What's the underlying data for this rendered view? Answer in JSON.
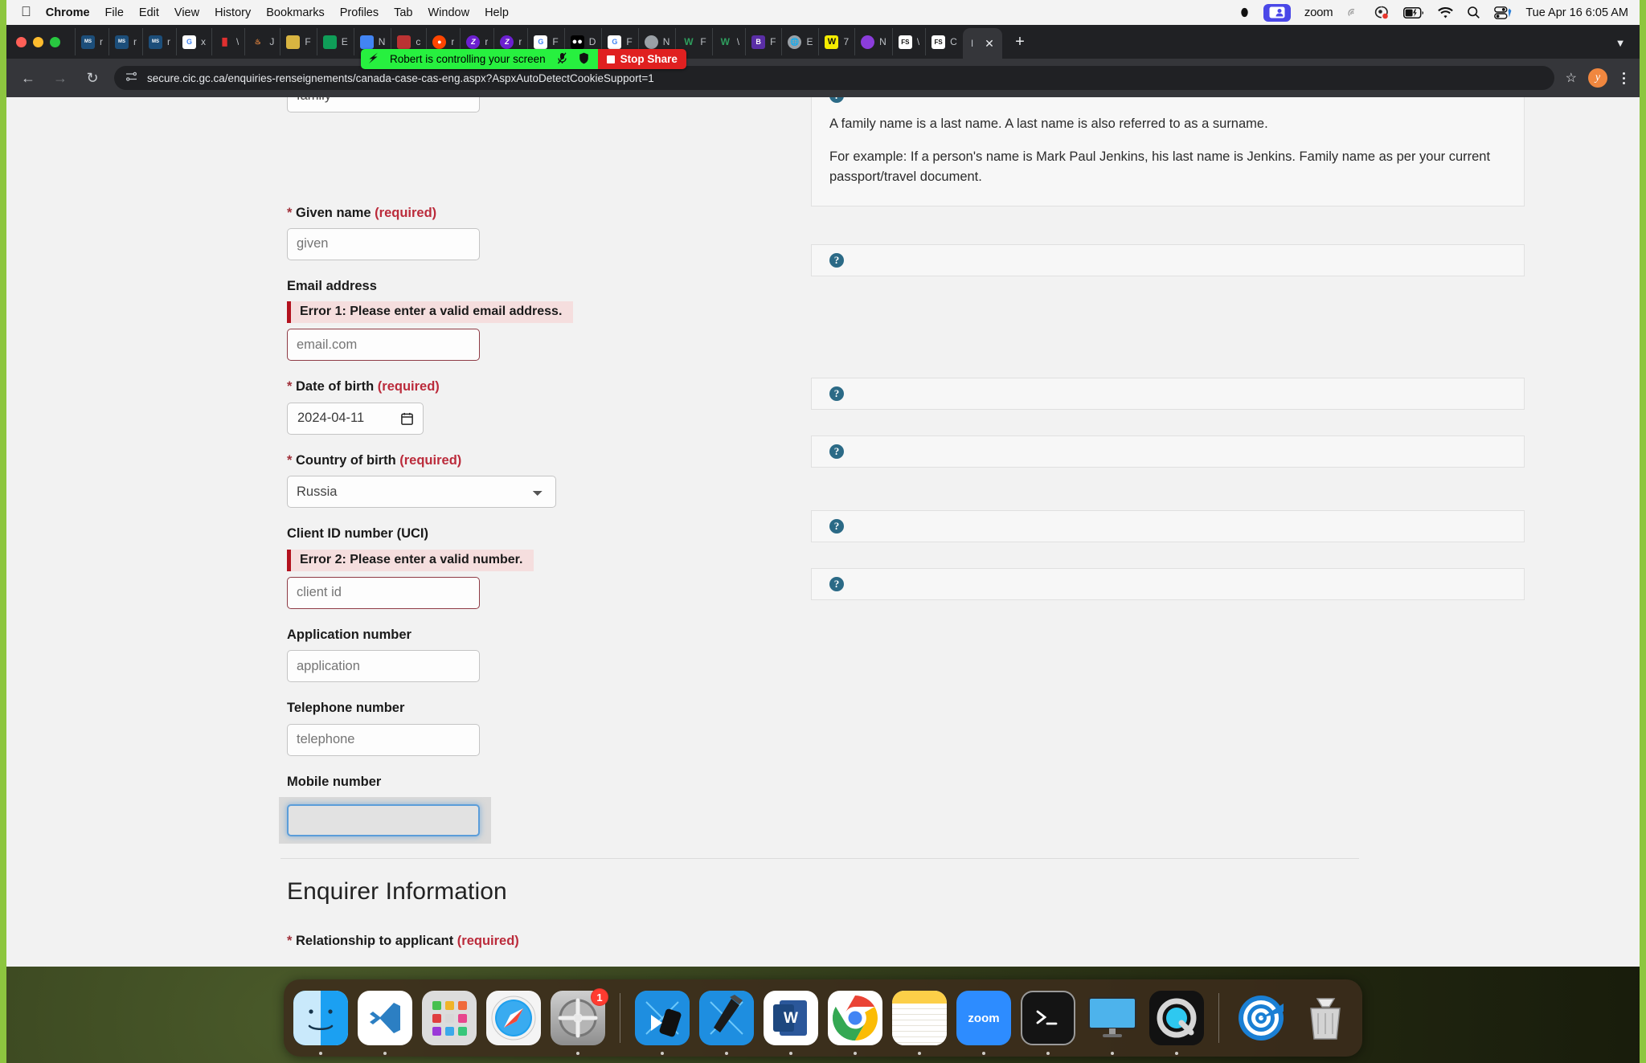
{
  "menubar": {
    "apple_icon": "apple-icon",
    "items": [
      {
        "label": "Chrome",
        "bold": true
      },
      {
        "label": "File",
        "bold": false
      },
      {
        "label": "Edit",
        "bold": false
      },
      {
        "label": "View",
        "bold": false
      },
      {
        "label": "History",
        "bold": false
      },
      {
        "label": "Bookmarks",
        "bold": false
      },
      {
        "label": "Profiles",
        "bold": false
      },
      {
        "label": "Tab",
        "bold": false
      },
      {
        "label": "Window",
        "bold": false
      },
      {
        "label": "Help",
        "bold": false
      }
    ],
    "status": {
      "record_icon": "record-dot-icon",
      "screenshare_icon": "screen-share-icon",
      "zoom_label": "zoom",
      "airplay_icon": "airplay-icon",
      "recording_icon": "screen-recording-icon",
      "battery_icon": "battery-charging-icon",
      "wifi_icon": "wifi-icon",
      "search_icon": "spotlight-search-icon",
      "controlcenter_icon": "control-center-icon",
      "datetime": "Tue Apr 16  6:05 AM"
    }
  },
  "sharebar": {
    "bolt_icon": "zoom-bolt-icon",
    "message": "Robert is controlling your screen",
    "mute_icon": "microphone-muted-icon",
    "shield_icon": "security-shield-icon",
    "stop_label": "Stop Share"
  },
  "browser": {
    "traffic_lights": [
      "close",
      "minimize",
      "maximize"
    ],
    "tabs": [
      {
        "favicon": "morgan-stanley-icon",
        "title": "r",
        "fav_bg": "#1c4e7a",
        "fav_text": "MS",
        "active": false
      },
      {
        "favicon": "morgan-stanley-icon",
        "title": "r",
        "fav_bg": "#1c4e7a",
        "fav_text": "MS",
        "active": false
      },
      {
        "favicon": "morgan-stanley-icon",
        "title": "r",
        "fav_bg": "#1c4e7a",
        "fav_text": "MS",
        "active": false
      },
      {
        "favicon": "google-icon",
        "title": "x",
        "fav_bg": "#ffffff",
        "fav_text": "G",
        "active": false
      },
      {
        "favicon": "pause-icon",
        "title": "\\",
        "fav_bg": "#202124",
        "fav_text": "II",
        "active": false
      },
      {
        "favicon": "java-icon",
        "title": "J",
        "fav_bg": "#202124",
        "fav_text": "J",
        "active": false
      },
      {
        "favicon": "unknown-icon",
        "title": "F",
        "fav_bg": "#d8b441",
        "fav_text": "",
        "active": false
      },
      {
        "favicon": "sheets-icon",
        "title": "E",
        "fav_bg": "#0f9d58",
        "fav_text": "",
        "active": false
      },
      {
        "favicon": "chrome-icon",
        "title": "N",
        "fav_bg": "#4285f4",
        "fav_text": "",
        "active": false
      },
      {
        "favicon": "unknown-icon",
        "title": "c",
        "fav_bg": "#b33",
        "fav_text": "",
        "active": false
      },
      {
        "favicon": "reddit-icon",
        "title": "r",
        "fav_bg": "#ff4500",
        "fav_text": "",
        "active": false
      },
      {
        "favicon": "zoom-icon",
        "title": "r",
        "fav_bg": "#6c20d0",
        "fav_text": "Z",
        "active": false
      },
      {
        "favicon": "zoom-icon",
        "title": "r",
        "fav_bg": "#6c20d0",
        "fav_text": "Z",
        "active": false
      },
      {
        "favicon": "google-icon",
        "title": "F",
        "fav_bg": "#ffffff",
        "fav_text": "G",
        "active": false
      },
      {
        "favicon": "medium-icon",
        "title": "D",
        "fav_bg": "#000000",
        "fav_text": "",
        "active": false
      },
      {
        "favicon": "google-icon",
        "title": "F",
        "fav_bg": "#ffffff",
        "fav_text": "G",
        "active": false
      },
      {
        "favicon": "chromium-icon",
        "title": "N",
        "fav_bg": "#9aa0a6",
        "fav_text": "",
        "active": false
      },
      {
        "favicon": "wolfram-icon",
        "title": "F",
        "fav_bg": "#202124",
        "fav_text": "W",
        "active": false
      },
      {
        "favicon": "wolfram-icon",
        "title": "\\",
        "fav_bg": "#202124",
        "fav_text": "W",
        "active": false
      },
      {
        "favicon": "bitbucket-icon",
        "title": "F",
        "fav_bg": "#5a2ea6",
        "fav_text": "B",
        "active": false
      },
      {
        "favicon": "globe-icon",
        "title": "E",
        "fav_bg": "#9aa0a6",
        "fav_text": "",
        "active": false
      },
      {
        "favicon": "wolfram-notebook-icon",
        "title": "7",
        "fav_bg": "#f5ec00",
        "fav_text": "W",
        "active": false
      },
      {
        "favicon": "roblox-icon",
        "title": "N",
        "fav_bg": "#8b3ddb",
        "fav_text": "",
        "active": false
      },
      {
        "favicon": "fs-icon",
        "title": "\\",
        "fav_bg": "#ffffff",
        "fav_text": "FS",
        "active": false
      },
      {
        "favicon": "fs-icon",
        "title": "C",
        "fav_bg": "#ffffff",
        "fav_text": "FS",
        "active": false
      },
      {
        "favicon": "active-tab-icon",
        "title": "I",
        "fav_bg": "#35363a",
        "fav_text": "",
        "active": true
      }
    ],
    "new_tab_label": "+",
    "tab_list_icon": "chevron-down-icon",
    "back_icon": "back-arrow-icon",
    "forward_icon": "forward-arrow-icon",
    "reload_icon": "reload-icon",
    "site_info_icon": "site-settings-icon",
    "url": "secure.cic.gc.ca/enquiries-renseignements/canada-case-cas-eng.aspx?AspxAutoDetectCookieSupport=1",
    "bookmark_icon": "star-icon",
    "profile_initial": "y",
    "menu_icon": "kebab-menu-icon"
  },
  "form": {
    "family_name": {
      "value": "family",
      "help_icon": "help-question-icon",
      "help_paragraphs": [
        "A family name is a last name. A last name is also referred to as a surname.",
        "For example: If a person's name is Mark Paul Jenkins, his last name is Jenkins. Family name as per your current passport/travel document."
      ]
    },
    "given_name": {
      "label": "Given name",
      "required_text": "(required)",
      "placeholder": "given",
      "help_icon": "help-question-icon"
    },
    "email": {
      "label": "Email address",
      "error": "Error 1: Please enter a valid email address.",
      "placeholder": "email.com"
    },
    "dob": {
      "label": "Date of birth",
      "required_text": "(required)",
      "value": "2024-04-11",
      "calendar_icon": "calendar-icon",
      "help_icon": "help-question-icon"
    },
    "country": {
      "label": "Country of birth",
      "required_text": "(required)",
      "value": "Russia",
      "help_icon": "help-question-icon"
    },
    "client_id": {
      "label": "Client ID number (UCI)",
      "error": "Error 2: Please enter a valid number.",
      "placeholder": "client id",
      "help_icon": "help-question-icon"
    },
    "application_number": {
      "label": "Application number",
      "placeholder": "application",
      "help_icon": "help-question-icon"
    },
    "telephone": {
      "label": "Telephone number",
      "placeholder": "telephone"
    },
    "mobile": {
      "label": "Mobile number",
      "value": ""
    },
    "section_heading": "Enquirer Information",
    "relationship": {
      "label": "Relationship to applicant",
      "required_text": "(required)"
    }
  },
  "dock": {
    "items": [
      {
        "name": "finder",
        "badge": null,
        "running": true
      },
      {
        "name": "visual-studio-code",
        "badge": null,
        "running": true
      },
      {
        "name": "launchpad",
        "badge": null,
        "running": false
      },
      {
        "name": "safari",
        "badge": null,
        "running": false
      },
      {
        "name": "system-settings",
        "badge": "1",
        "running": true
      },
      {
        "name": "separator",
        "badge": null,
        "running": false
      },
      {
        "name": "xcode-simulator",
        "badge": null,
        "running": true
      },
      {
        "name": "xcode",
        "badge": null,
        "running": true
      },
      {
        "name": "microsoft-word",
        "badge": null,
        "running": true
      },
      {
        "name": "google-chrome",
        "badge": null,
        "running": true
      },
      {
        "name": "notes",
        "badge": null,
        "running": true
      },
      {
        "name": "zoom",
        "badge": null,
        "running": true,
        "label": "zoom"
      },
      {
        "name": "terminal",
        "badge": null,
        "running": true
      },
      {
        "name": "screen-sharing",
        "badge": null,
        "running": true
      },
      {
        "name": "quicktime-player",
        "badge": null,
        "running": true
      },
      {
        "name": "separator2",
        "badge": null,
        "running": false
      },
      {
        "name": "airport-utility",
        "badge": null,
        "running": false
      },
      {
        "name": "trash",
        "badge": null,
        "running": false
      }
    ]
  },
  "colors": {
    "share_green": "#27f03f",
    "share_red": "#e02020",
    "border_green": "#8dc63f",
    "error_red": "#b3121f",
    "required_red": "#bb2b3b",
    "help_blue": "#2b6a86",
    "focus_blue": "#5b9dd9"
  }
}
